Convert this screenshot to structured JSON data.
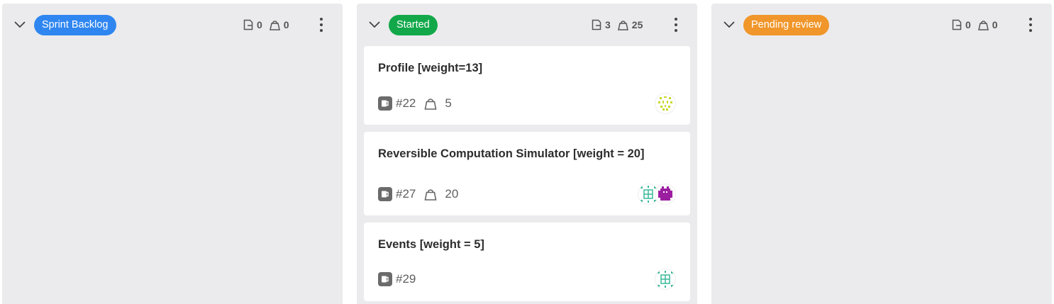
{
  "columns": [
    {
      "name": "Sprint Backlog",
      "color": "#2f86f0",
      "issue_count": "0",
      "weight_total": "0",
      "cards": []
    },
    {
      "name": "Started",
      "color": "#12a84a",
      "issue_count": "3",
      "weight_total": "25",
      "cards": [
        {
          "title": "Profile [weight=13]",
          "number": "#22",
          "weight": "5"
        },
        {
          "title": "Reversible Computation Simulator [weight = 20]",
          "number": "#27",
          "weight": "20"
        },
        {
          "title": "Events [weight = 5]",
          "number": "#29",
          "weight": ""
        }
      ]
    },
    {
      "name": "Pending review",
      "color": "#f0962a",
      "issue_count": "0",
      "weight_total": "0",
      "cards": []
    }
  ],
  "avatar_colors": {
    "yellow_green": "#c8d82a",
    "teal": "#3ab89a",
    "magenta": "#9b1ea0"
  },
  "icons": {
    "collapse": "chevron-down-icon",
    "issues": "issue-icon",
    "weight": "weight-icon",
    "menu": "kebab-menu-icon"
  }
}
